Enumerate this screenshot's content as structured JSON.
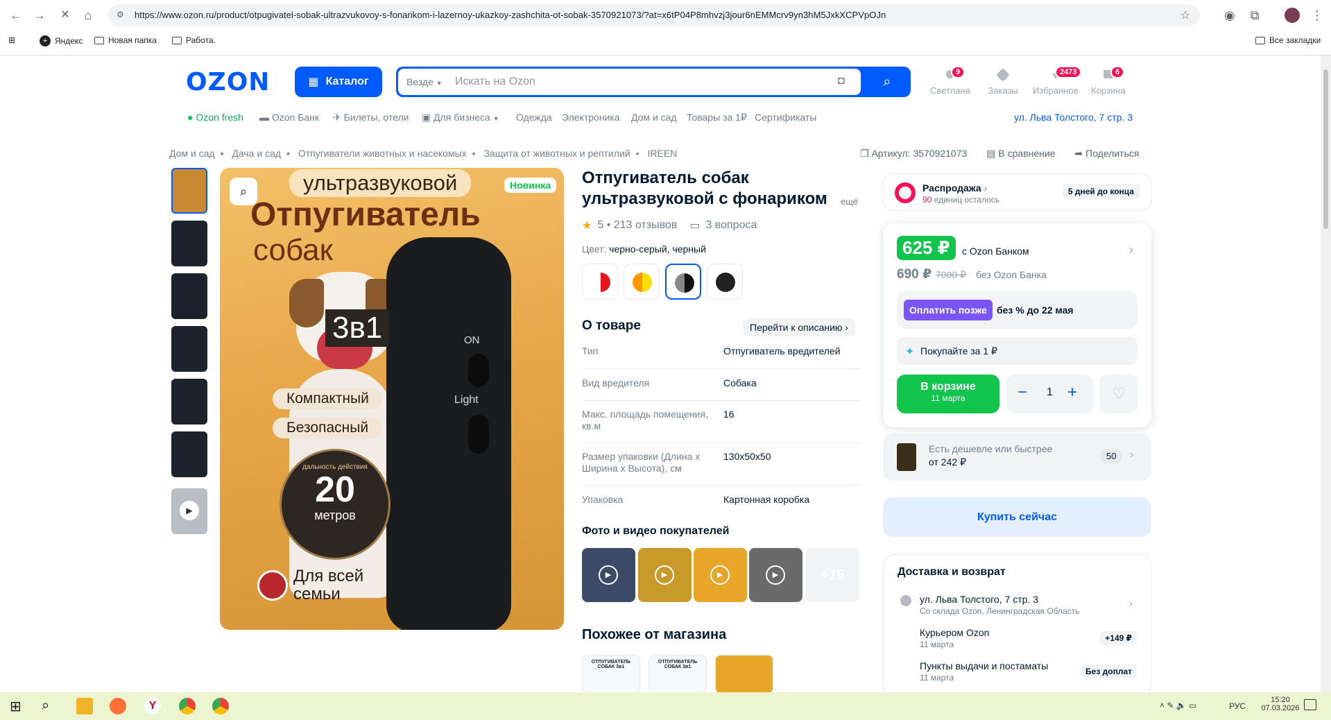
{
  "browser": {
    "url": "https://www.ozon.ru/product/otpugivatel-sobak-ultrazvukovoy-s-fonarikom-i-lazernoy-ukazkoy-zashchita-ot-sobak-3570921073/?at=x6tP04P8mhvzj3jour6nEMMcrv9yn3hM5JxkXCPVpOJn",
    "bookmarks": [
      "Яндекс",
      "Новая папка",
      "Работа."
    ],
    "all_bookmarks": "Все закладки"
  },
  "header": {
    "logo": "OZON",
    "catalog": "Каталог",
    "search_scope": "Везде",
    "search_placeholder": "Искать на Ozon",
    "actions": [
      {
        "label": "Светлана",
        "badge": "9"
      },
      {
        "label": "Заказы",
        "badge": ""
      },
      {
        "label": "Избранное",
        "badge": "2473"
      },
      {
        "label": "Корзина",
        "badge": "6"
      }
    ],
    "subnav": [
      "Ozon fresh",
      "Ozon Банк",
      "Билеты, отели",
      "Для бизнеса",
      "Одежда",
      "Электроника",
      "Дом и сад",
      "Товары за 1₽",
      "Сертификаты"
    ],
    "address": "ул. Льва Толстого, 7 стр. 3"
  },
  "breadcrumbs": [
    "Дом и сад",
    "Дача и сад",
    "Отпугиватели животных и насекомых",
    "Защита от животных и рептилий",
    "IREEN"
  ],
  "top_actions": {
    "article": "Артикул: 3570921073",
    "compare": "В сравнение",
    "share": "Поделиться"
  },
  "gallery": {
    "badge": "Новинка",
    "img_lines": {
      "top": "ультразвуковой",
      "big1": "Отпугиватель",
      "big2": "собак",
      "combo": "3в1",
      "pill1": "Компактный",
      "pill2": "Безопасный",
      "dist_num": "20",
      "dist_unit": "метров",
      "dist_ring": "дальность действия",
      "family1": "Для всей",
      "family2": "семьи",
      "btn_on": "ON",
      "btn_light": "Light"
    }
  },
  "product": {
    "title": "Отпугиватель собак ультразвуковой с фонариком",
    "title_more": "ещё",
    "rating": "5 • 213 отзывов",
    "questions": "3 вопроса",
    "color_label": "Цвет:",
    "color_value": "черно-серый, черный",
    "about": "О товаре",
    "goto_desc": "Перейти к описанию",
    "specs": [
      {
        "k": "Тип",
        "v": "Отпугиватель вредителей"
      },
      {
        "k": "Вид вредителя",
        "v": "Собака"
      },
      {
        "k": "Макс. площадь помещения, кв.м",
        "v": "16"
      },
      {
        "k": "Размер упаковки (Длина х Ширина х Высота), см",
        "v": "130x50x50"
      },
      {
        "k": "Упаковка",
        "v": "Картонная коробка"
      }
    ],
    "photos_title": "Фото и видео покупателей",
    "photos_more": "+16",
    "similar_title": "Похожее от магазина",
    "similar_card_text": "ОТПУГИВАТЕЛЬ СОБАК 3в1"
  },
  "buy_panel": {
    "sale_title": "Распродажа",
    "sale_units": "90",
    "sale_units_text": "единиц осталось",
    "sale_days": "5 дней до конца",
    "price_card": "625 ₽",
    "price_card_note": "с Ozon Банком",
    "price_regular": "690 ₽",
    "price_old": "7000 ₽",
    "price_regular_note": "без Ozon Банка",
    "pay_later_btn": "Оплатить позже",
    "pay_later_note": "без % до 22 мая",
    "one_rub": "Покупайте за 1 ₽",
    "in_cart": "В корзине",
    "in_cart_date": "11 марта",
    "qty": "1",
    "cheaper_line1": "Есть дешевле или быстрее",
    "cheaper_line2": "от 242 ₽",
    "cheaper_count": "50",
    "buy_now": "Купить сейчас"
  },
  "delivery": {
    "title": "Доставка и возврат",
    "address": "ул. Льва Толстого, 7 стр. 3",
    "warehouse": "Со склада Ozon, Ленинградская Область",
    "options": [
      {
        "name": "Курьером Ozon",
        "date": "11 марта",
        "price": "+149 ₽"
      },
      {
        "name": "Пункты выдачи и постаматы",
        "date": "11 марта",
        "price": "Без доплат"
      }
    ]
  },
  "taskbar": {
    "lang": "РУС",
    "time": "15:20",
    "date": "07.03.2026"
  },
  "colors": {
    "brand": "#005bff",
    "green": "#10c44c",
    "pink": "#f91155"
  }
}
